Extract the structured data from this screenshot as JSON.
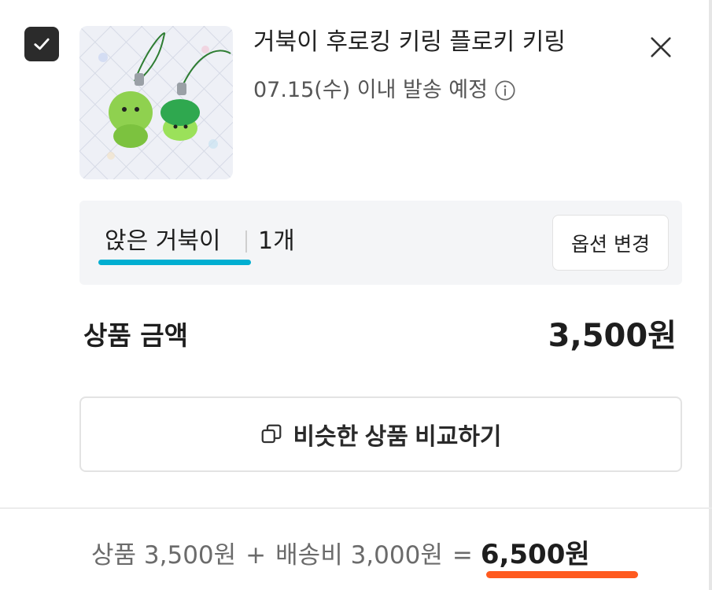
{
  "item": {
    "checked": true,
    "title": "거북이 후로킹 키링 플로키 키링",
    "ship_text": "07.15(수) 이내 발송 예정"
  },
  "option": {
    "name": "앉은 거북이",
    "quantity": "1개",
    "change_label": "옵션 변경",
    "highlight_color": "#00aed1"
  },
  "price": {
    "label": "상품 금액",
    "value": "3,500원"
  },
  "compare": {
    "label": "비슷한 상품 비교하기"
  },
  "summary": {
    "product": "상품 3,500원",
    "plus": "+",
    "shipping": "배송비 3,000원",
    "equals": "=",
    "total": "6,500원",
    "highlight_color": "#ff5a1f"
  },
  "icons": {
    "checkbox": "check-icon",
    "close": "close-icon",
    "info": "info-icon",
    "compare": "copy-icon"
  }
}
